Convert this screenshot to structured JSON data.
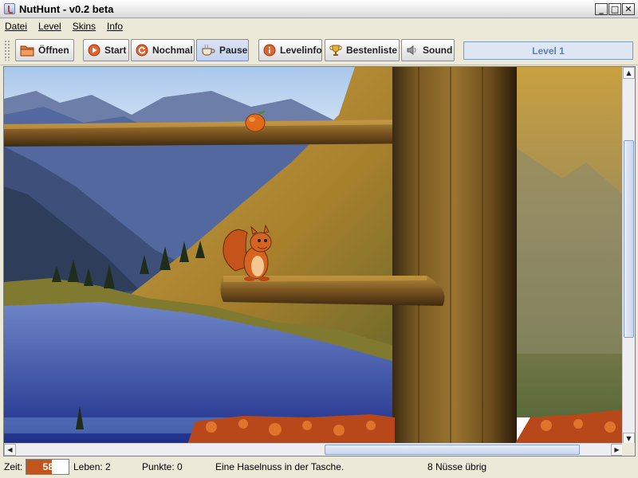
{
  "window": {
    "title": "NutHunt - v0.2 beta"
  },
  "menu": [
    "Datei",
    "Level",
    "Skins",
    "Info"
  ],
  "toolbar": {
    "open": "Öffnen",
    "start": "Start",
    "again": "Nochmal",
    "pause": "Pause",
    "levelinfo": "Levelinfo",
    "highscores": "Bestenliste",
    "sound": "Sound"
  },
  "level": "Level 1",
  "status": {
    "time_label": "Zeit:",
    "time_value": "58",
    "time_fraction": 0.6,
    "lives": "Leben: 2",
    "points": "Punkte: 0",
    "message": "Eine Haselnuss in der Tasche.",
    "nuts_left": "8 Nüsse übrig"
  },
  "colors": {
    "time_fill": "#c0561c",
    "level_text": "#5b7fb3"
  }
}
